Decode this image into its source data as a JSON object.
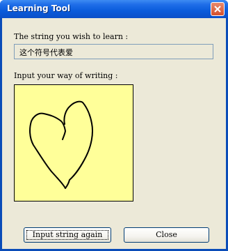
{
  "window": {
    "title": "Learning Tool"
  },
  "learn": {
    "label": "The string you wish to learn :",
    "value": "这个符号代表爱"
  },
  "writing": {
    "label": "Input your way of writing :",
    "canvas_color": "#ffff99",
    "stroke_color": "#000000"
  },
  "buttons": {
    "input_again": "Input string again",
    "close": "Close"
  },
  "icons": {
    "close": "close-icon"
  }
}
